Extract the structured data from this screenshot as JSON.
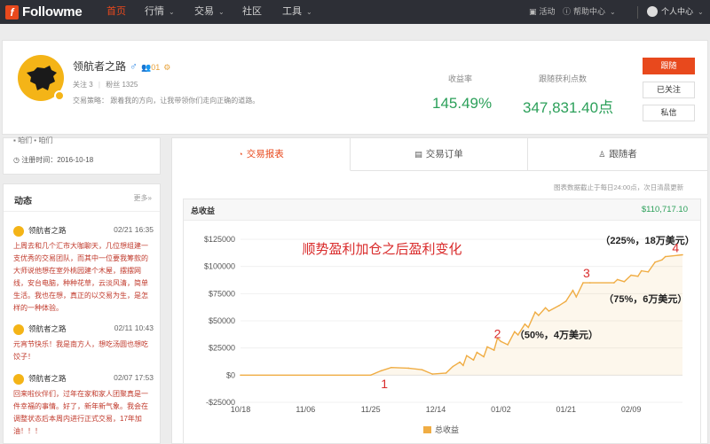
{
  "nav": {
    "logo_text": "Followme",
    "items": [
      {
        "label": "首页",
        "active": true
      },
      {
        "label": "行情",
        "dropdown": true
      },
      {
        "label": "交易",
        "dropdown": true
      },
      {
        "label": "社区"
      },
      {
        "label": "工具",
        "dropdown": true
      }
    ],
    "activity": "活动",
    "help": "帮助中心",
    "user_center": "个人中心"
  },
  "profile": {
    "name": "领航者之路",
    "gender_symbol": "♂",
    "level": "01",
    "follow_label": "关注",
    "follow_count": "3",
    "fans_label": "粉丝",
    "fans_count": "1325",
    "strategy_label": "交易策略：",
    "strategy_text": "跟着我的方向，让我带领你们走向正确的道路。",
    "return_label": "收益率",
    "return_value": "145.49%",
    "points_label": "跟随获利点数",
    "points_value": "347,831.40点",
    "follow_btn": "跟随",
    "followed_btn": "已关注",
    "message_btn": "私信"
  },
  "left": {
    "cut_text": "咱们 • 咱们",
    "register": "注册时间：2016-10-18",
    "dynamics_title": "动态",
    "more": "更多",
    "posts": [
      {
        "name": "领航者之路",
        "date": "02/21 16:35",
        "text": "上周去和几个汇市大咖聊天，几位想组建一支优秀的交易团队，而其中一位要我筹款的大师说他想在室外桃园建个木屋，摆摆网线，安台电脑，种种花草，云淡风清，简单生活。我也在想，真正的以交易为生，是怎样的一种体验。"
      },
      {
        "name": "领航者之路",
        "date": "02/11 10:43",
        "text": "元宵节快乐！我是南方人，想吃汤圆也想吃饺子！"
      },
      {
        "name": "领航者之路",
        "date": "02/07 17:53",
        "text": "回来啦伙伴们，过年在家和家人团聚真是一件幸福的事情。好了，新年新气象。我会在调整状态后本周内进行正式交易，17年加油！！！"
      }
    ]
  },
  "tabs": [
    {
      "label": "交易报表",
      "icon": "report-icon",
      "active": true
    },
    {
      "label": "交易订单",
      "icon": "order-icon"
    },
    {
      "label": "跟随者",
      "icon": "user-icon"
    }
  ],
  "update_note": "图表数据截止于每日24:00点，次日清晨更新",
  "chart_header": {
    "title": "总收益",
    "total": "$110,717.10"
  },
  "chart_data": {
    "type": "area",
    "title": "",
    "xlabel": "",
    "ylabel": "",
    "ylim": [
      -25000,
      125000
    ],
    "yticks": [
      "-$25000",
      "$0",
      "$25000",
      "$50000",
      "$75000",
      "$100000",
      "$125000"
    ],
    "xticks": [
      "10/18",
      "11/06",
      "11/25",
      "12/14",
      "01/02",
      "01/21",
      "02/09"
    ],
    "legend": "总收益",
    "line_color": "#f0ad44",
    "x_range": [
      "2016-10-18",
      "2017-02-24"
    ],
    "points": [
      [
        "2016-10-18",
        0
      ],
      [
        "2016-11-25",
        0
      ],
      [
        "2016-11-28",
        4000
      ],
      [
        "2016-12-01",
        7000
      ],
      [
        "2016-12-06",
        6500
      ],
      [
        "2016-12-10",
        5000
      ],
      [
        "2016-12-13",
        1000
      ],
      [
        "2016-12-17",
        2000
      ],
      [
        "2016-12-19",
        8000
      ],
      [
        "2016-12-21",
        12000
      ],
      [
        "2016-12-22",
        9000
      ],
      [
        "2016-12-23",
        18000
      ],
      [
        "2016-12-25",
        14000
      ],
      [
        "2016-12-26",
        21000
      ],
      [
        "2016-12-28",
        17000
      ],
      [
        "2016-12-29",
        26000
      ],
      [
        "2016-12-31",
        23000
      ],
      [
        "2017-01-01",
        34000
      ],
      [
        "2017-01-02",
        31000
      ],
      [
        "2017-01-04",
        28000
      ],
      [
        "2017-01-06",
        40000
      ],
      [
        "2017-01-07",
        37000
      ],
      [
        "2017-01-09",
        47000
      ],
      [
        "2017-01-10",
        44000
      ],
      [
        "2017-01-12",
        58000
      ],
      [
        "2017-01-13",
        55000
      ],
      [
        "2017-01-15",
        62000
      ],
      [
        "2017-01-16",
        59000
      ],
      [
        "2017-01-19",
        64000
      ],
      [
        "2017-01-21",
        68000
      ],
      [
        "2017-01-23",
        78000
      ],
      [
        "2017-01-24",
        72000
      ],
      [
        "2017-01-26",
        85000
      ],
      [
        "2017-01-28",
        85000
      ],
      [
        "2017-02-04",
        85000
      ],
      [
        "2017-02-05",
        88000
      ],
      [
        "2017-02-07",
        86000
      ],
      [
        "2017-02-09",
        92000
      ],
      [
        "2017-02-11",
        91000
      ],
      [
        "2017-02-12",
        96000
      ],
      [
        "2017-02-14",
        95000
      ],
      [
        "2017-02-16",
        104000
      ],
      [
        "2017-02-18",
        106000
      ],
      [
        "2017-02-19",
        109000
      ],
      [
        "2017-02-24",
        110717
      ]
    ],
    "annotations": [
      {
        "text": "顺势盈利加仓之后盈利变化",
        "x": "2016-11-05",
        "y": 112000,
        "color": "#d92b2b",
        "size": 15
      },
      {
        "text": "1",
        "x": "2016-11-28",
        "y": -12000,
        "color": "#d92b2b",
        "size": 14
      },
      {
        "text": "2",
        "x": "2016-12-31",
        "y": 34000,
        "color": "#d92b2b",
        "size": 14
      },
      {
        "text": "（50%，4万美元）",
        "x": "2017-01-06",
        "y": 34000,
        "color": "#222",
        "size": 11,
        "bold": true
      },
      {
        "text": "3",
        "x": "2017-01-26",
        "y": 90000,
        "color": "#d92b2b",
        "size": 14
      },
      {
        "text": "（75%，6万美元）",
        "x": "2017-02-01",
        "y": 67000,
        "color": "#222",
        "size": 11,
        "bold": true
      },
      {
        "text": "（225%，18万美元）",
        "x": "2017-01-31",
        "y": 121000,
        "color": "#222",
        "size": 11,
        "bold": true
      },
      {
        "text": "4",
        "x": "2017-02-21",
        "y": 113000,
        "color": "#d92b2b",
        "size": 14
      }
    ]
  }
}
